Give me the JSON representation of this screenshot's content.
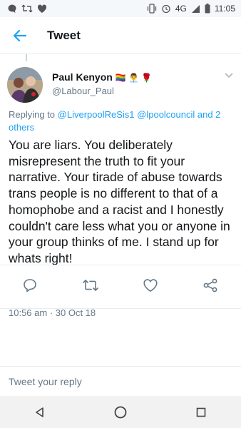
{
  "status": {
    "time": "11:05",
    "network": "4G"
  },
  "appbar": {
    "title": "Tweet"
  },
  "tweet": {
    "author_name": "Paul Kenyon",
    "author_badges": "🏳️‍🌈 👨‍💼 🌹",
    "handle": "@Labour_Paul",
    "replying_prefix": "Replying to",
    "replying_links": "@LiverpoolReSis1 @lpoolcouncil and 2 others",
    "body": "You are liars. You deliberately misrepresent the truth to fit your narrative. Your tirade of abuse towards trans people is no different to that of a homophobe and a racist and I honestly couldn't care less what you or anyone in your group thinks of me. I stand up for whats right!",
    "timestamp": "10:56 am · 30 Oct 18"
  },
  "reply": {
    "placeholder": "Tweet your reply"
  },
  "colors": {
    "accent": "#1da1f2",
    "muted": "#657786",
    "text": "#14171a"
  }
}
